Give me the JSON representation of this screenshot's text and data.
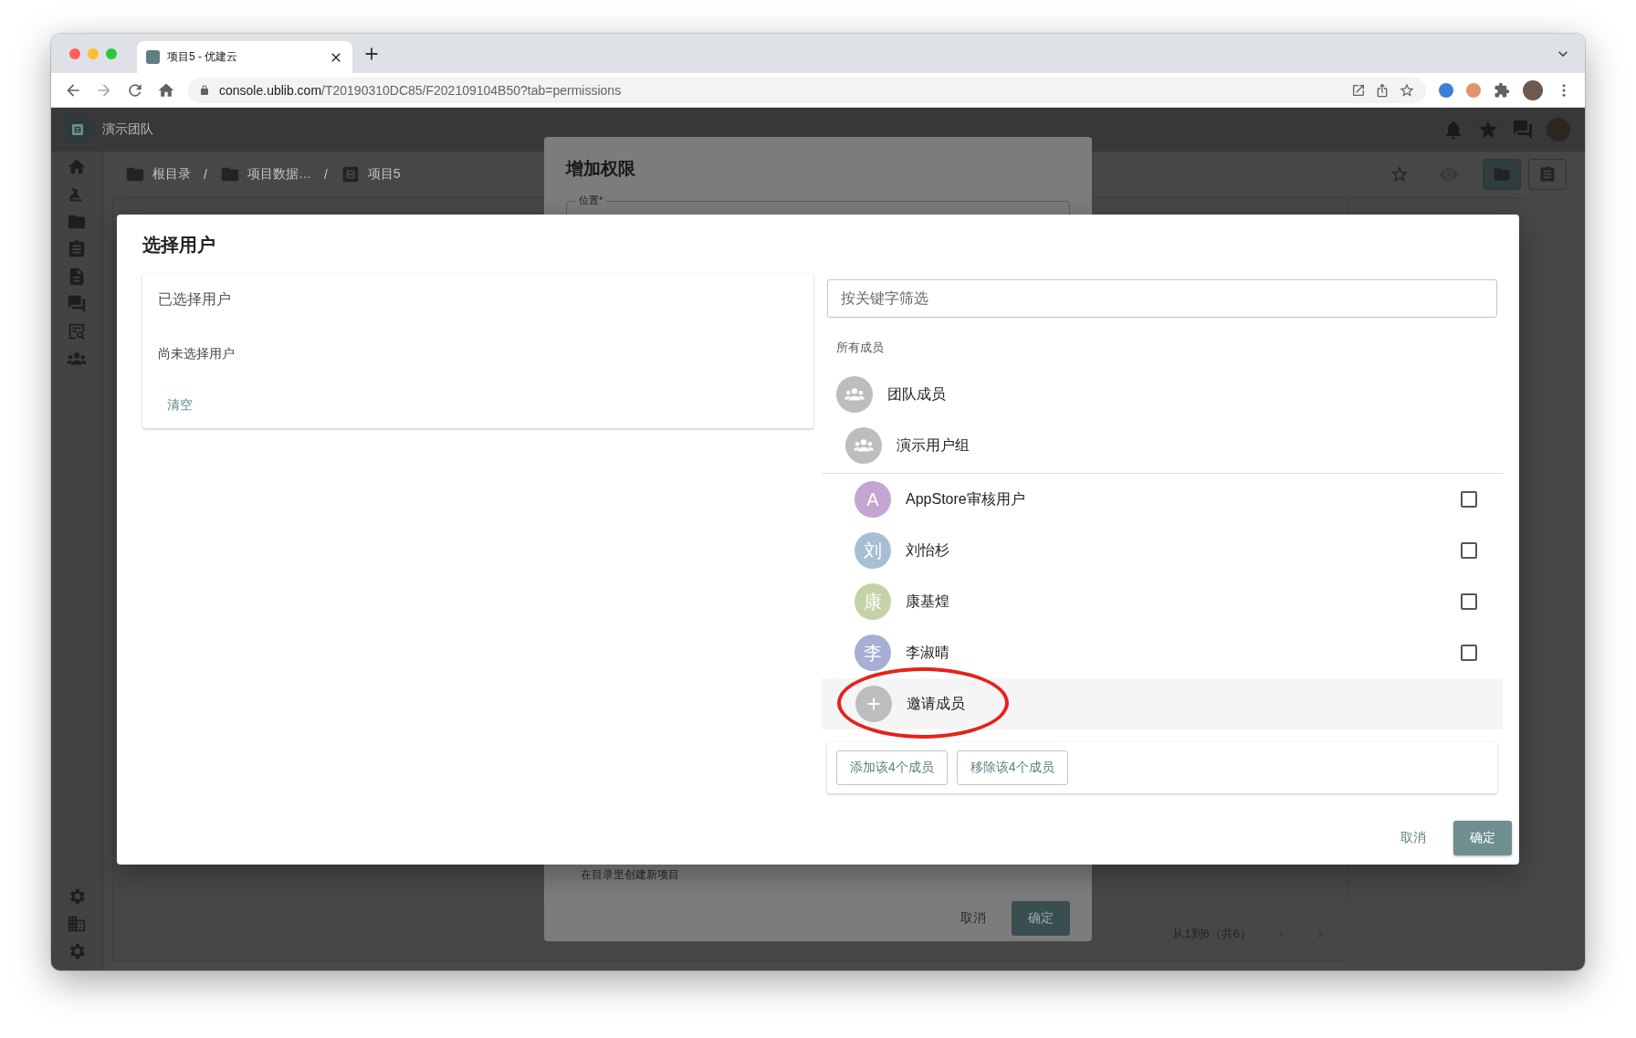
{
  "browser": {
    "tab_title": "项目5 - 优建云",
    "url_host": "console.ublib.com",
    "url_rest": "/T20190310DC85/F202109104B50?tab=permissions"
  },
  "app_header": {
    "team_name": "演示团队"
  },
  "breadcrumbs": [
    {
      "label": "根目录",
      "kind": "folder"
    },
    {
      "separator": "/",
      "label": "项目数据…",
      "kind": "folder"
    },
    {
      "separator": "/",
      "label": "项目5",
      "kind": "project"
    }
  ],
  "back_dialog": {
    "title": "增加权限",
    "field_label": "位置*",
    "hint": "在目录里创建新项目",
    "buttons": [
      {
        "label": "取消",
        "kind": "text"
      },
      {
        "label": "确定",
        "kind": "primary"
      }
    ]
  },
  "pagination": {
    "range": "从1到6（共6）"
  },
  "select_dialog": {
    "title": "选择用户",
    "selected_panel": {
      "title": "已选择用户",
      "empty_text": "尚未选择用户",
      "clear": "清空"
    },
    "search": {
      "placeholder": "按关键字筛选"
    },
    "section_label": "所有成员",
    "groups": [
      {
        "name": "团队成员",
        "children": [
          {
            "name": "演示用户组",
            "children": [
              {
                "name": "AppStore审核用户",
                "initial": "A",
                "color": "#c4a5d1",
                "checked": false
              },
              {
                "name": "刘怡杉",
                "initial": "刘",
                "color": "#a8bed3",
                "checked": false
              },
              {
                "name": "康基煌",
                "initial": "康",
                "color": "#c5d2a6",
                "checked": false
              },
              {
                "name": "李淑晴",
                "initial": "李",
                "color": "#a8add3",
                "checked": false
              }
            ]
          }
        ]
      }
    ],
    "invite": {
      "label": "邀请成员"
    },
    "bulk_buttons": [
      "添加该4个成员",
      "移除该4个成员"
    ],
    "footer_buttons": [
      {
        "label": "取消",
        "kind": "text"
      },
      {
        "label": "确定",
        "kind": "primary"
      }
    ]
  }
}
